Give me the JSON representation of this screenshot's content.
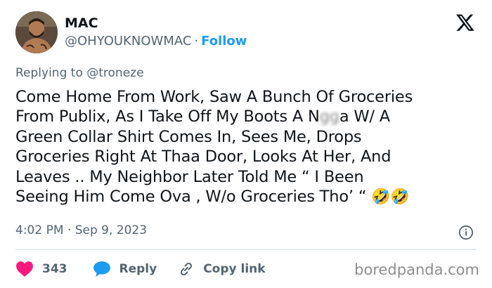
{
  "author": {
    "name": "MAC",
    "handle": "@OHYOUKNOWMAC",
    "separator": "·",
    "follow_label": "Follow"
  },
  "reply": {
    "prefix": "Replying to",
    "mention": "@troneze"
  },
  "tweet": {
    "lines": [
      "Come Home From Work, Saw A Bunch Of Groceries",
      "From Publix, As I Take Off My Boots A N",
      "Green Collar Shirt Comes In, Sees Me, Drops",
      "Groceries Right At Thaa Door, Looks At Her, And",
      "Leaves .. My Neighbor Later Told Me “ I Been",
      "Seeing Him Come Ova , W/o Groceries Tho’ “"
    ],
    "censored_word": "gg",
    "line2_tail": "a W/ A",
    "emoji": "🤣🤣"
  },
  "meta": {
    "time": "4:02 PM",
    "separator": "·",
    "date": "Sep 9, 2023"
  },
  "actions": {
    "like_count": "343",
    "reply_label": "Reply",
    "copy_label": "Copy link"
  },
  "watermark": "boredpanda.com",
  "colors": {
    "like_red": "#f91880",
    "reply_blue": "#1d9bf0",
    "muted": "#536471",
    "text": "#0f1419"
  },
  "icons": [
    "x-logo-icon",
    "info-icon",
    "heart-icon",
    "reply-bubble-icon",
    "link-icon"
  ]
}
